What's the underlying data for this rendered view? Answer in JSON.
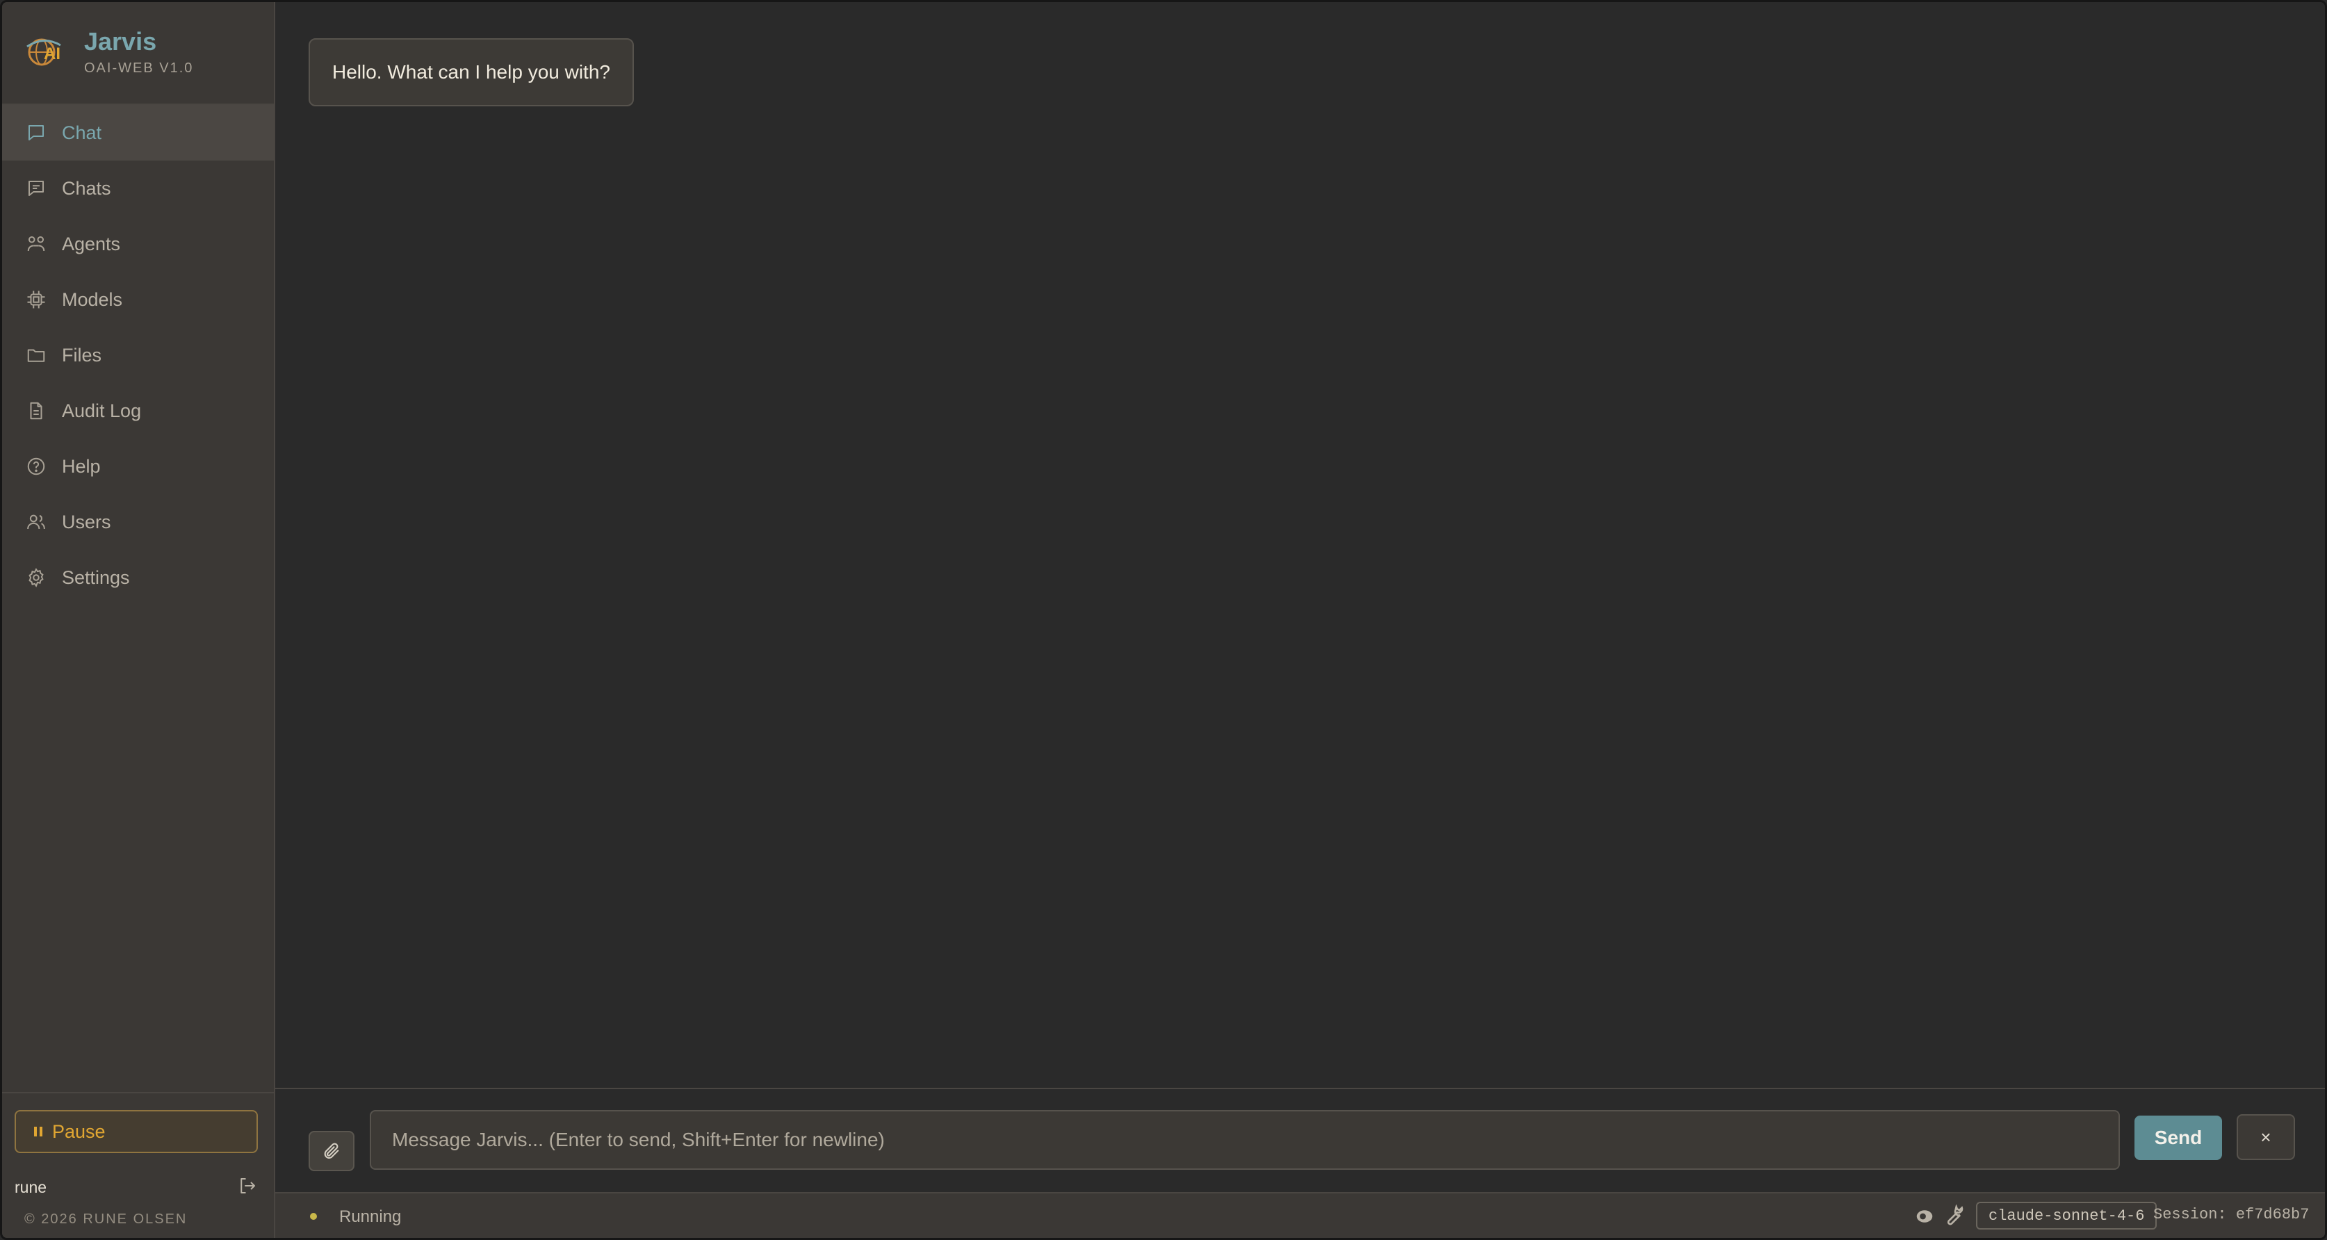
{
  "brand": {
    "title": "Jarvis",
    "subtitle": "OAI-WEB V1.0",
    "logo_icon": "ai-globe-icon",
    "logo_text": "AI"
  },
  "sidebar": {
    "items": [
      {
        "label": "Chat",
        "icon": "chat-bubble-icon",
        "active": true
      },
      {
        "label": "Chats",
        "icon": "chats-icon",
        "active": false
      },
      {
        "label": "Agents",
        "icon": "agents-icon",
        "active": false
      },
      {
        "label": "Models",
        "icon": "chip-icon",
        "active": false
      },
      {
        "label": "Files",
        "icon": "folder-icon",
        "active": false
      },
      {
        "label": "Audit Log",
        "icon": "document-icon",
        "active": false
      },
      {
        "label": "Help",
        "icon": "help-circle-icon",
        "active": false
      },
      {
        "label": "Users",
        "icon": "users-icon",
        "active": false
      },
      {
        "label": "Settings",
        "icon": "gear-icon",
        "active": false
      }
    ],
    "pause_label": "Pause",
    "username": "rune",
    "copyright": "© 2026 RUNE OLSEN"
  },
  "chat": {
    "messages": [
      {
        "role": "assistant",
        "text": "Hello. What can I help you with?"
      }
    ]
  },
  "composer": {
    "placeholder": "Message Jarvis... (Enter to send, Shift+Enter for newline)",
    "value": "",
    "send_label": "Send",
    "close_label": "×"
  },
  "status": {
    "state": "Running",
    "model": "claude-sonnet-4-6",
    "session": "Session: ef7d68b7"
  },
  "colors": {
    "accent": "#7aa7ae",
    "send_button": "#5d8c93",
    "pause": "#e0a632",
    "status_dot": "#c9b84a"
  }
}
